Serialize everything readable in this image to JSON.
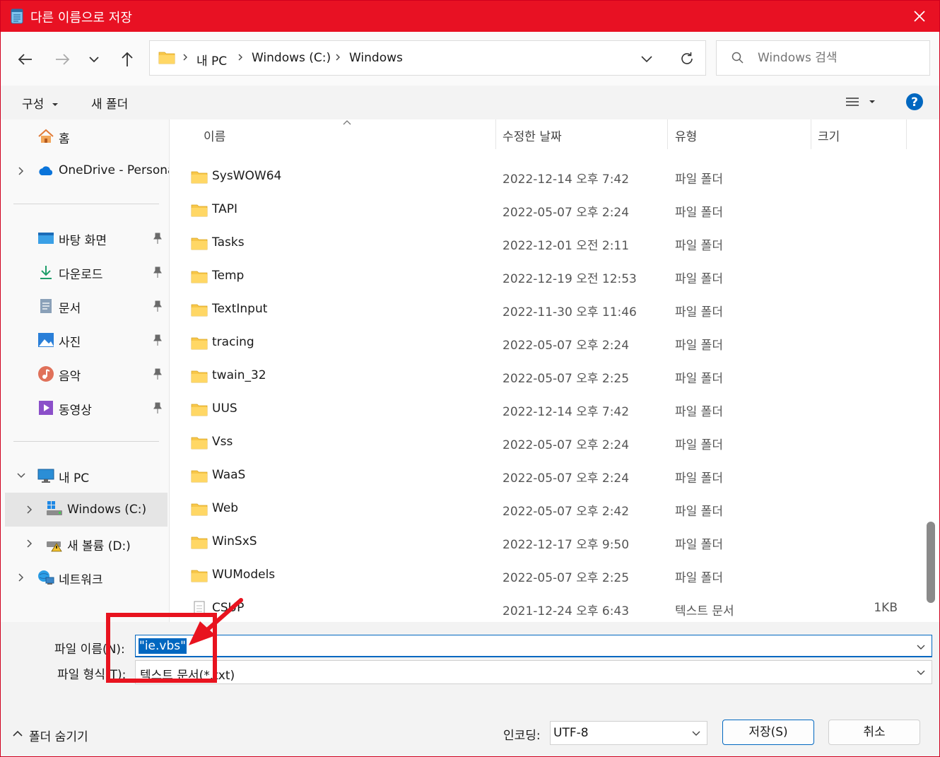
{
  "window": {
    "title": "다른 이름으로 저장",
    "accent_color": "#e81123",
    "select_color": "#0067c0"
  },
  "address": {
    "crumbs": [
      "내 PC",
      "Windows (C:)",
      "Windows"
    ]
  },
  "search": {
    "placeholder": "Windows 검색"
  },
  "toolbar": {
    "organize": "구성",
    "new_folder": "새 폴더"
  },
  "sidebar": {
    "home": "홈",
    "onedrive": "OneDrive - Persona",
    "desktop": "바탕 화면",
    "downloads": "다운로드",
    "documents": "문서",
    "pictures": "사진",
    "music": "음악",
    "videos": "동영상",
    "this_pc": "내 PC",
    "drive_c": "Windows (C:)",
    "drive_d": "새 볼륨 (D:)",
    "network": "네트워크"
  },
  "columns": {
    "name": "이름",
    "modified": "수정한 날짜",
    "type": "유형",
    "size": "크기"
  },
  "files": [
    {
      "name": "SysWOW64",
      "date": "2022-12-14 오후 7:42",
      "type": "파일 폴더",
      "size": ""
    },
    {
      "name": "TAPI",
      "date": "2022-05-07 오후 2:24",
      "type": "파일 폴더",
      "size": ""
    },
    {
      "name": "Tasks",
      "date": "2022-12-01 오전 2:11",
      "type": "파일 폴더",
      "size": ""
    },
    {
      "name": "Temp",
      "date": "2022-12-19 오전 12:53",
      "type": "파일 폴더",
      "size": ""
    },
    {
      "name": "TextInput",
      "date": "2022-11-30 오후 11:46",
      "type": "파일 폴더",
      "size": ""
    },
    {
      "name": "tracing",
      "date": "2022-05-07 오후 2:24",
      "type": "파일 폴더",
      "size": ""
    },
    {
      "name": "twain_32",
      "date": "2022-05-07 오후 2:25",
      "type": "파일 폴더",
      "size": ""
    },
    {
      "name": "UUS",
      "date": "2022-12-14 오후 7:42",
      "type": "파일 폴더",
      "size": ""
    },
    {
      "name": "Vss",
      "date": "2022-05-07 오후 2:24",
      "type": "파일 폴더",
      "size": ""
    },
    {
      "name": "WaaS",
      "date": "2022-05-07 오후 2:24",
      "type": "파일 폴더",
      "size": ""
    },
    {
      "name": "Web",
      "date": "2022-05-07 오후 2:42",
      "type": "파일 폴더",
      "size": ""
    },
    {
      "name": "WinSxS",
      "date": "2022-12-17 오후 9:50",
      "type": "파일 폴더",
      "size": ""
    },
    {
      "name": "WUModels",
      "date": "2022-05-07 오후 2:25",
      "type": "파일 폴더",
      "size": ""
    },
    {
      "name": "CSUP",
      "date": "2021-12-24 오후 6:43",
      "type": "텍스트 문서",
      "size": "1KB"
    }
  ],
  "footer": {
    "filename_label": "파일 이름(N):",
    "filename_value": "\"ie.vbs\"",
    "filetype_label": "파일 형식(T):",
    "filetype_value": "텍스트 문서(*.txt)",
    "encoding_label": "인코딩:",
    "encoding_value": "UTF-8",
    "save": "저장(S)",
    "cancel": "취소",
    "hide_folders": "폴더 숨기기"
  },
  "annotation": {
    "color": "#e8131f"
  }
}
